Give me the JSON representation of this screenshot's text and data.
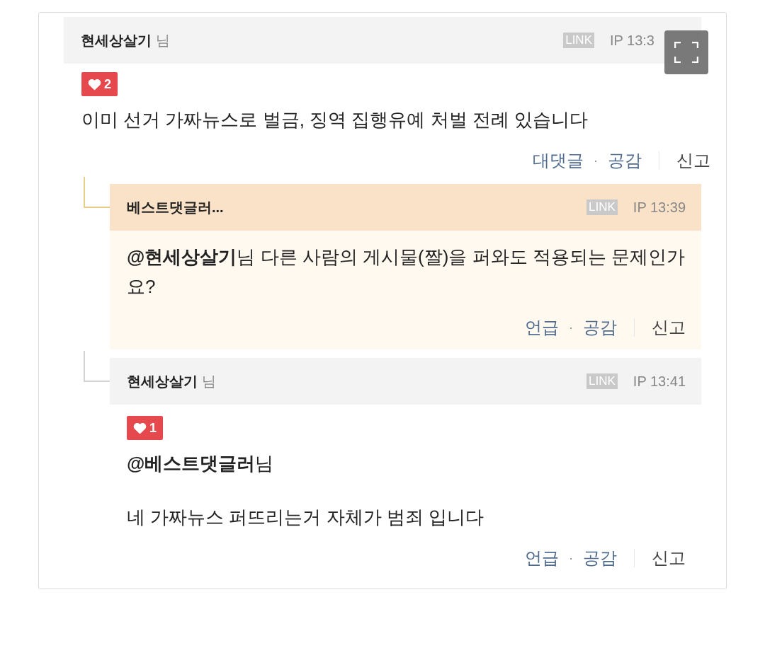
{
  "comments": [
    {
      "author": "현세상살기",
      "suffix": "님",
      "link_badge": "LINK",
      "time": "IP 13:3",
      "highlighted": false,
      "likes": "2",
      "paragraphs": [
        "이미 선거 가짜뉴스로 벌금, 징역 집행유예 처벌 전례 있습니다"
      ],
      "actions": [
        "대댓글",
        "공감"
      ],
      "separator": "·",
      "report": "신고",
      "children": [
        {
          "author": "베스트댓글러...",
          "link_badge": "LINK",
          "time": "IP 13:39",
          "highlighted": true,
          "paragraphs": [
            "**@현세상살기**님 다른 사람의 게시물(짤)을 퍼와도 적용되는 문제인가요?"
          ],
          "actions": [
            "언급",
            "공감"
          ],
          "separator": "·",
          "report": "신고"
        },
        {
          "author": "현세상살기",
          "suffix": "님",
          "link_badge": "LINK",
          "time": "IP 13:41",
          "highlighted": false,
          "likes": "1",
          "paragraphs": [
            "**@베스트댓글러**님",
            "네 가짜뉴스 퍼뜨리는거 자체가 범죄 입니다"
          ],
          "actions": [
            "언급",
            "공감"
          ],
          "separator": "·",
          "report": "신고"
        }
      ]
    }
  ]
}
